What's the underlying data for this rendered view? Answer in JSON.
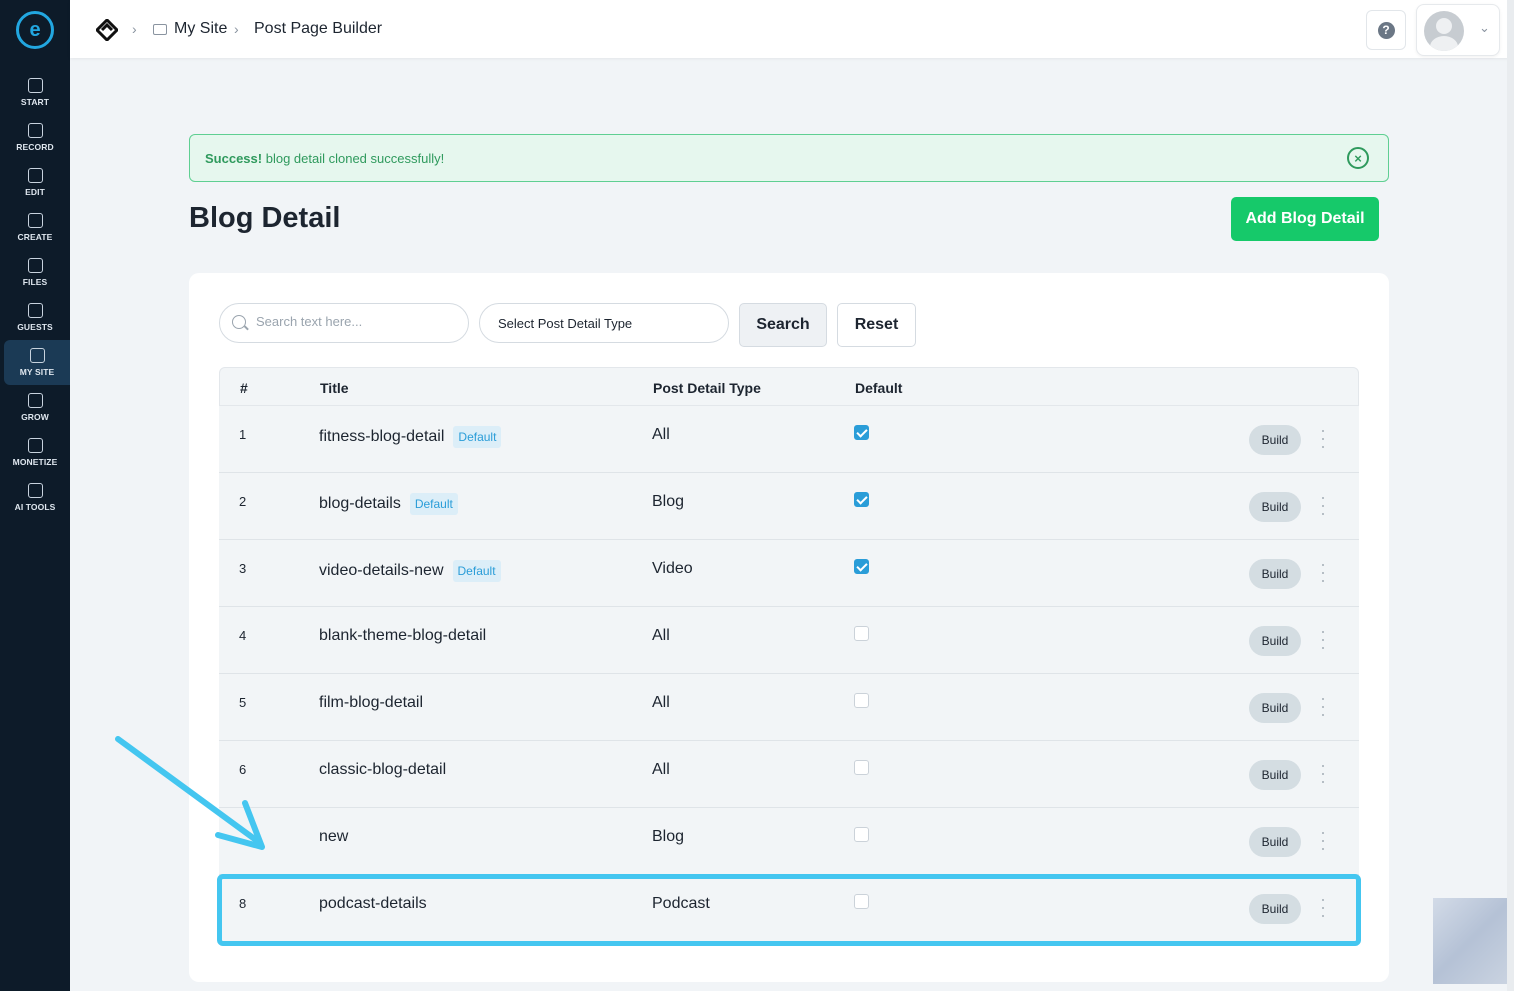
{
  "sidebar": {
    "items": [
      {
        "label": "START",
        "icon": "start-icon"
      },
      {
        "label": "RECORD",
        "icon": "microphone-icon"
      },
      {
        "label": "EDIT",
        "icon": "edit-icon"
      },
      {
        "label": "CREATE",
        "icon": "create-icon"
      },
      {
        "label": "FILES",
        "icon": "files-icon"
      },
      {
        "label": "GUESTS",
        "icon": "guests-icon"
      },
      {
        "label": "MY SITE",
        "icon": "site-icon",
        "active": true
      },
      {
        "label": "GROW",
        "icon": "chart-icon"
      },
      {
        "label": "MONETIZE",
        "icon": "monetize-icon"
      },
      {
        "label": "AI TOOLS",
        "icon": "ai-icon"
      }
    ]
  },
  "breadcrumb": {
    "site": "My Site",
    "page": "Post Page Builder"
  },
  "header": {
    "help_icon": "?"
  },
  "alert": {
    "strong": "Success!",
    "message": "blog detail cloned successfully!"
  },
  "page": {
    "title": "Blog Detail",
    "add_button": "Add Blog Detail"
  },
  "filters": {
    "search_placeholder": "Search text here...",
    "select_label": "Select Post Detail Type",
    "search_button": "Search",
    "reset_button": "Reset"
  },
  "table": {
    "headers": {
      "num": "#",
      "title": "Title",
      "type": "Post Detail Type",
      "default": "Default"
    },
    "badge_label": "Default",
    "build_label": "Build",
    "rows": [
      {
        "num": "1",
        "title": "fitness-blog-detail",
        "badge": true,
        "type": "All",
        "default": true
      },
      {
        "num": "2",
        "title": "blog-details",
        "badge": true,
        "type": "Blog",
        "default": true
      },
      {
        "num": "3",
        "title": "video-details-new",
        "badge": true,
        "type": "Video",
        "default": true
      },
      {
        "num": "4",
        "title": "blank-theme-blog-detail",
        "badge": false,
        "type": "All",
        "default": false
      },
      {
        "num": "5",
        "title": "film-blog-detail",
        "badge": false,
        "type": "All",
        "default": false
      },
      {
        "num": "6",
        "title": "classic-blog-detail",
        "badge": false,
        "type": "All",
        "default": false
      },
      {
        "num": "",
        "title": "new",
        "badge": false,
        "type": "Blog",
        "default": false
      },
      {
        "num": "8",
        "title": "podcast-details",
        "badge": false,
        "type": "Podcast",
        "default": false
      }
    ]
  },
  "colors": {
    "sidebar_bg": "#0d1b29",
    "accent": "#2a9dd8",
    "success": "#16c96a",
    "annotation": "#44c6f0"
  }
}
